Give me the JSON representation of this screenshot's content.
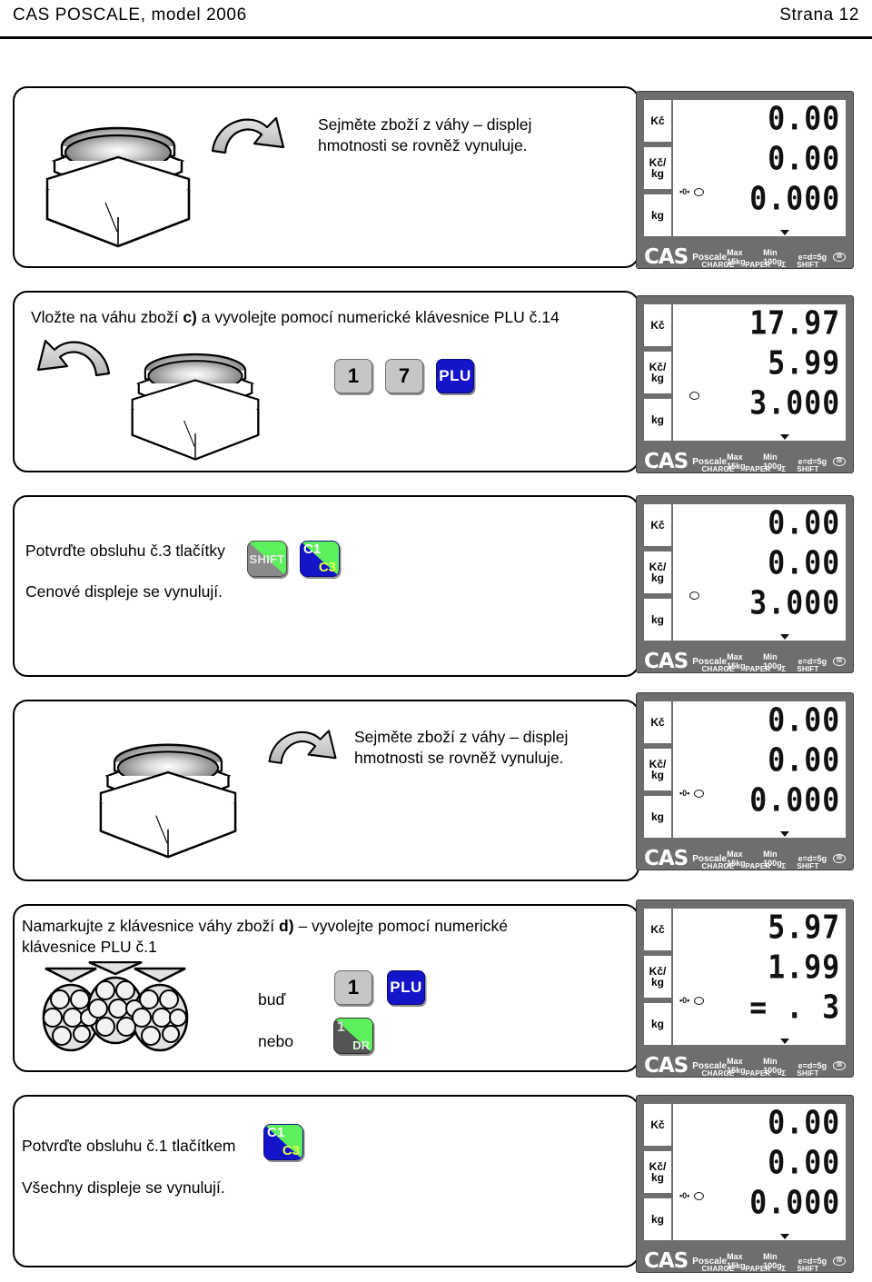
{
  "header": {
    "title": "CAS POSCALE, model 2006",
    "page": "Strana 12"
  },
  "steps": [
    {
      "id": "step-a",
      "text": "Sejměte zboží z váhy – displej\nhmotnosti se rovněž vynuluje.",
      "icon": "scale-empty-with-remove-arrow"
    },
    {
      "id": "step-c",
      "text_before": "Vložte na váhu zboží ",
      "text_bold": "c)",
      "text_after": " a vyvolejte pomocí numerické klávesnice PLU č.14",
      "keys": [
        "1",
        "7",
        "PLU"
      ]
    },
    {
      "id": "step-operator-3",
      "line1": "Potvrďte obsluhu č.3 tlačítky",
      "line2": "Cenové displeje se vynulují.",
      "keys": [
        "SHIFT",
        "C1/C3"
      ]
    },
    {
      "id": "step-remove",
      "text": "Sejměte zboží z váhy – displej\nhmotnosti se rovněž vynuluje."
    },
    {
      "id": "step-d",
      "text_before": "Namarkujte z klávesnice váhy zboží ",
      "text_bold": "d)",
      "text_after": " – vyvolejte pomocí numerické\nklávesnice PLU č.1",
      "alt_label_1": "buď",
      "alt_label_2": "nebo",
      "keys": [
        "1",
        "PLU",
        "1/DR"
      ]
    },
    {
      "id": "step-operator-1",
      "line1": "Potvrďte obsluhu č.1 tlačítkem",
      "line2": "Všechny displeje se vynulují.",
      "keys": [
        "C1/C3"
      ]
    }
  ],
  "keys": {
    "one": "1",
    "seven": "7",
    "plu": "PLU",
    "shift": "SHIFT",
    "c1": "C1",
    "c3": "C3",
    "dr_num": "1",
    "dr": "DR",
    "budh": "buď",
    "nebo": "nebo"
  },
  "display_common": {
    "unit_price_total": "Kč",
    "unit_per_kg": "Kč/\nkg",
    "unit_weight": "kg",
    "zero_label": "•0•",
    "status": [
      "CHARGE",
      "PAPER",
      "Σ",
      "SHIFT"
    ],
    "brand": "CAS",
    "model": "Poscale",
    "spec_max": "Max 15kg",
    "spec_min": "Min 100g",
    "spec_ed": "e=d=5g",
    "ce": "III"
  },
  "displays": [
    {
      "id": "display-1",
      "total": "0.00",
      "unit_price": "0.00",
      "weight": "0.000",
      "zero_on": true
    },
    {
      "id": "display-2",
      "total": "17.97",
      "unit_price": "5.99",
      "weight": "3.000",
      "zero_on": false
    },
    {
      "id": "display-3",
      "total": "0.00",
      "unit_price": "0.00",
      "weight": "3.000",
      "zero_on": false
    },
    {
      "id": "display-4",
      "total": "0.00",
      "unit_price": "0.00",
      "weight": "0.000",
      "zero_on": true
    },
    {
      "id": "display-5",
      "total": "5.97",
      "unit_price": "1.99",
      "weight": "= . 3",
      "zero_on": true
    },
    {
      "id": "display-6",
      "total": "0.00",
      "unit_price": "0.00",
      "weight": "0.000",
      "zero_on": true
    }
  ]
}
